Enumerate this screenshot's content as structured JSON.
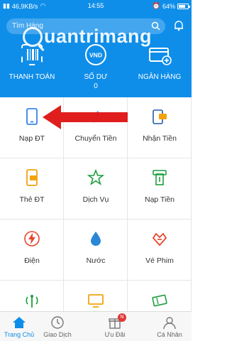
{
  "status_bar": {
    "signal": "46,9KB/s",
    "time": "14:55",
    "battery": "64%"
  },
  "search": {
    "placeholder": "Tìm Hàng"
  },
  "watermark": {
    "text": "uantrimang"
  },
  "quick_actions": [
    {
      "label": "THANH TOÁN",
      "icon": "barcode-scan-icon"
    },
    {
      "label": "SỐ DƯ",
      "sub": "0",
      "icon": "vnd-coin-icon",
      "icon_text": "VND"
    },
    {
      "label": "NGÂN HÀNG",
      "icon": "bank-card-icon"
    }
  ],
  "services": [
    {
      "label": "Nạp ĐT",
      "icon": "phone-topup-icon"
    },
    {
      "label": "Chuyển Tiền",
      "icon": "transfer-icon"
    },
    {
      "label": "Nhận Tiền",
      "icon": "receive-money-icon"
    },
    {
      "label": "Thẻ ĐT",
      "icon": "phone-card-icon"
    },
    {
      "label": "Dịch Vụ",
      "icon": "star-service-icon"
    },
    {
      "label": "Nạp Tiền",
      "icon": "atm-deposit-icon"
    },
    {
      "label": "Điện",
      "icon": "electricity-icon"
    },
    {
      "label": "Nước",
      "icon": "water-drop-icon"
    },
    {
      "label": "Vé Phim",
      "icon": "movie-ticket-icon"
    },
    {
      "label": "",
      "icon": "internet-antenna-icon"
    },
    {
      "label": "",
      "icon": "tv-icon"
    },
    {
      "label": "",
      "icon": "ticket-icon"
    }
  ],
  "tabs": [
    {
      "label": "Trang Chủ",
      "icon": "home-icon",
      "active": true
    },
    {
      "label": "Giao Dịch",
      "icon": "clock-icon"
    },
    {
      "label": "Ưu Đãi",
      "icon": "gift-icon",
      "badge": "N"
    },
    {
      "label": "Cá Nhân",
      "icon": "user-icon"
    }
  ],
  "colors": {
    "brand": "#0f8ee9",
    "arrow": "#e01e1e"
  }
}
